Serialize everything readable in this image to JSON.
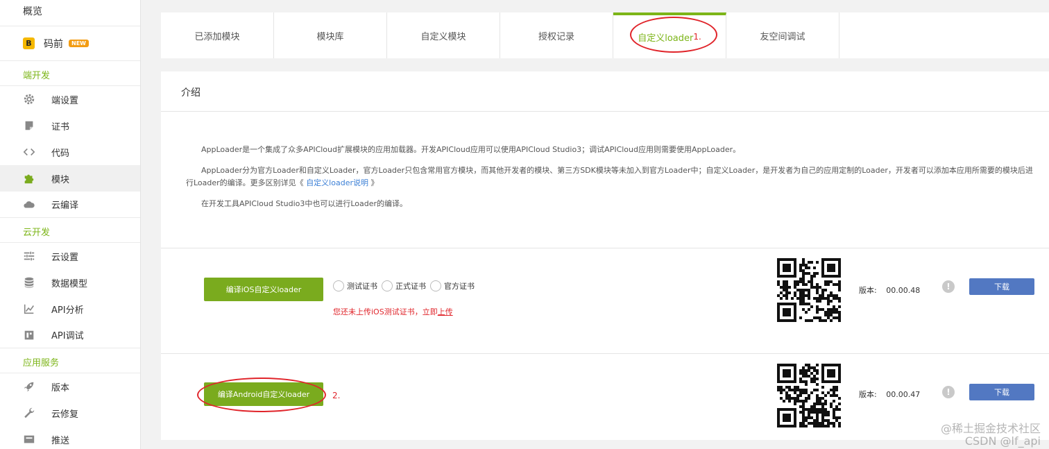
{
  "sidebar": {
    "overview": "概览",
    "maqian": {
      "label": "码前",
      "badge": "NEW",
      "logo": "B"
    },
    "sections": [
      {
        "title": "端开发",
        "items": [
          {
            "label": "端设置",
            "icon": "gear-icon"
          },
          {
            "label": "证书",
            "icon": "certificate-icon"
          },
          {
            "label": "代码",
            "icon": "code-icon"
          },
          {
            "label": "模块",
            "icon": "puzzle-icon",
            "active": true
          },
          {
            "label": "云编译",
            "icon": "cloud-icon"
          }
        ]
      },
      {
        "title": "云开发",
        "items": [
          {
            "label": "云设置",
            "icon": "sliders-icon"
          },
          {
            "label": "数据模型",
            "icon": "database-icon"
          },
          {
            "label": "API分析",
            "icon": "chart-icon"
          },
          {
            "label": "API调试",
            "icon": "debug-icon"
          }
        ]
      },
      {
        "title": "应用服务",
        "items": [
          {
            "label": "版本",
            "icon": "rocket-icon"
          },
          {
            "label": "云修复",
            "icon": "wrench-icon"
          },
          {
            "label": "推送",
            "icon": "push-icon"
          }
        ]
      }
    ]
  },
  "tabs": [
    {
      "label": "已添加模块"
    },
    {
      "label": "模块库"
    },
    {
      "label": "自定义模块"
    },
    {
      "label": "授权记录"
    },
    {
      "label": "自定义loader",
      "mark": "1.",
      "active": true
    },
    {
      "label": "友空间调试"
    }
  ],
  "card": {
    "title": "介绍",
    "paragraphs": [
      "AppLoader是一个集成了众多APICloud扩展模块的应用加载器。开发APICloud应用可以使用APICloud Studio3；调试APICloud应用则需要使用AppLoader。",
      "AppLoader分为官方Loader和自定义Loader，官方Loader只包含常用官方模块，而其他开发者的模块、第三方SDK模块等未加入到官方Loader中；自定义Loader，是开发者为自己的应用定制的Loader，开发者可以添加本应用所需要的模块后进行Loader的编译。更多区别详见《",
      "在开发工具APICloud Studio3中也可以进行Loader的编译。"
    ],
    "link_text": "自定义loader说明",
    "link_close": "》"
  },
  "ios": {
    "button": "编译iOS自定义loader",
    "radios": [
      "测试证书",
      "正式证书",
      "官方证书"
    ],
    "warning": "您还未上传iOS测试证书，立即",
    "warning_link": "上传",
    "version_label": "版本:",
    "version": "00.00.48",
    "download": "下载"
  },
  "android": {
    "button": "编译Android自定义loader",
    "mark": "2.",
    "version_label": "版本:",
    "version": "00.00.47",
    "download": "下载"
  },
  "watermark": {
    "line1": "@稀土掘金技术社区",
    "line2": "CSDN @lf_api"
  },
  "colors": {
    "accent": "#7cb518",
    "annotation": "#e0242a",
    "download": "#5278c2"
  }
}
